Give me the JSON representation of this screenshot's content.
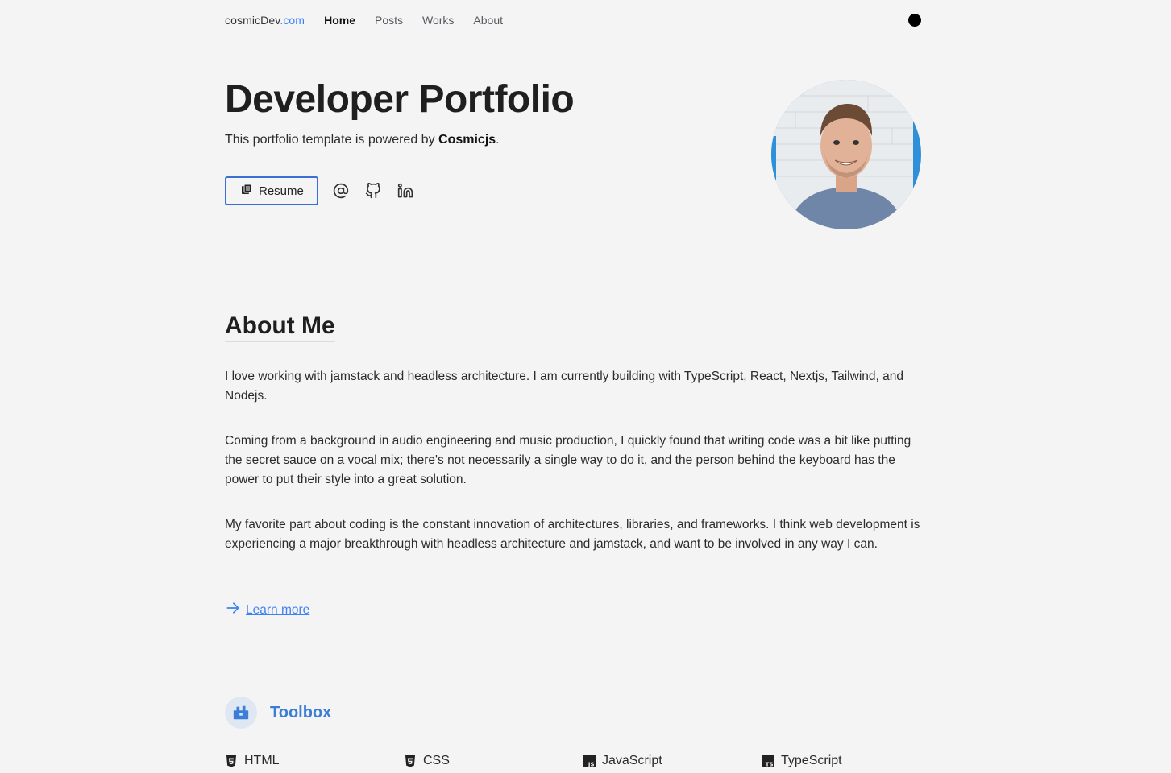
{
  "nav": {
    "brand_name": "cosmicDev",
    "brand_tld": ".com",
    "links": [
      {
        "label": "Home"
      },
      {
        "label": "Posts"
      },
      {
        "label": "Works"
      },
      {
        "label": "About"
      }
    ]
  },
  "hero": {
    "title": "Developer Portfolio",
    "subtitle_prefix": "This portfolio template is powered by ",
    "subtitle_brand": "Cosmicjs",
    "subtitle_suffix": ".",
    "resume_label": "Resume"
  },
  "about": {
    "title": "About Me",
    "paragraphs": [
      "I love working with jamstack and headless architecture. I am currently building with TypeScript, React, Nextjs, Tailwind, and Nodejs.",
      "Coming from a background in audio engineering and music production, I quickly found that writing code was a bit like putting the secret sauce on a vocal mix; there's not necessarily a single way to do it, and the person behind the keyboard has the power to put their style into a great solution.",
      "My favorite part about coding is the constant innovation of architectures, libraries, and frameworks. I think web development is experiencing a major breakthrough with headless architecture and jamstack, and want to be involved in any way I can."
    ],
    "learn_more": "Learn more"
  },
  "toolbox": {
    "title": "Toolbox",
    "tools": [
      {
        "label": "HTML",
        "icon": "html5-icon"
      },
      {
        "label": "CSS",
        "icon": "css3-icon"
      },
      {
        "label": "JavaScript",
        "icon": "javascript-icon"
      },
      {
        "label": "TypeScript",
        "icon": "typescript-icon"
      }
    ]
  },
  "colors": {
    "accent": "#3b82f6",
    "background": "#f4f4f4",
    "text": "#1f1f1f"
  }
}
